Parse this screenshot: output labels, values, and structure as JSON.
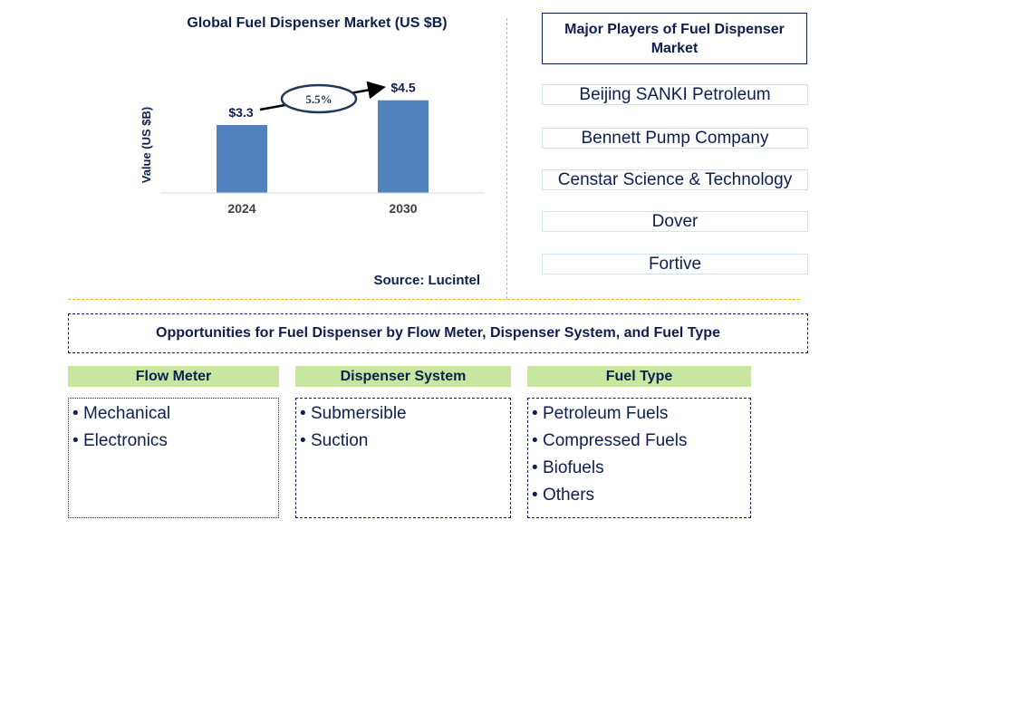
{
  "chart_data": {
    "type": "bar",
    "title": "Global Fuel Dispenser Market (US $B)",
    "xlabel": "",
    "ylabel": "Value (US $B)",
    "categories": [
      "2024",
      "2030"
    ],
    "values": [
      3.3,
      4.5
    ],
    "data_labels": [
      "$3.3",
      "$4.5"
    ],
    "ylim": [
      0,
      5.5
    ],
    "grid": false,
    "bar_color": "#4f81bd",
    "annotation": {
      "type": "cagr-arrow",
      "label": "5.5%",
      "from": "2024",
      "to": "2030"
    }
  },
  "source": "Source: Lucintel",
  "players": {
    "header": "Major Players of Fuel Dispenser Market",
    "items": [
      "Beijing SANKI Petroleum",
      "Bennett Pump Company",
      "Censtar Science & Technology",
      "Dover",
      "Fortive"
    ]
  },
  "opportunities": {
    "header": "Opportunities for Fuel Dispenser by Flow Meter, Dispenser System, and Fuel Type",
    "bullet": "•",
    "categories": [
      {
        "title": "Flow Meter",
        "items": [
          "Mechanical",
          "Electronics"
        ]
      },
      {
        "title": "Dispenser System",
        "items": [
          "Submersible",
          "Suction"
        ]
      },
      {
        "title": "Fuel Type",
        "items": [
          "Petroleum Fuels",
          "Compressed Fuels",
          "Biofuels",
          "Others"
        ]
      }
    ]
  },
  "colors": {
    "text": "#0d1f4f",
    "bar": "#4f81bd",
    "category_header": "#c8e6a0",
    "divider": "#f5b800"
  }
}
